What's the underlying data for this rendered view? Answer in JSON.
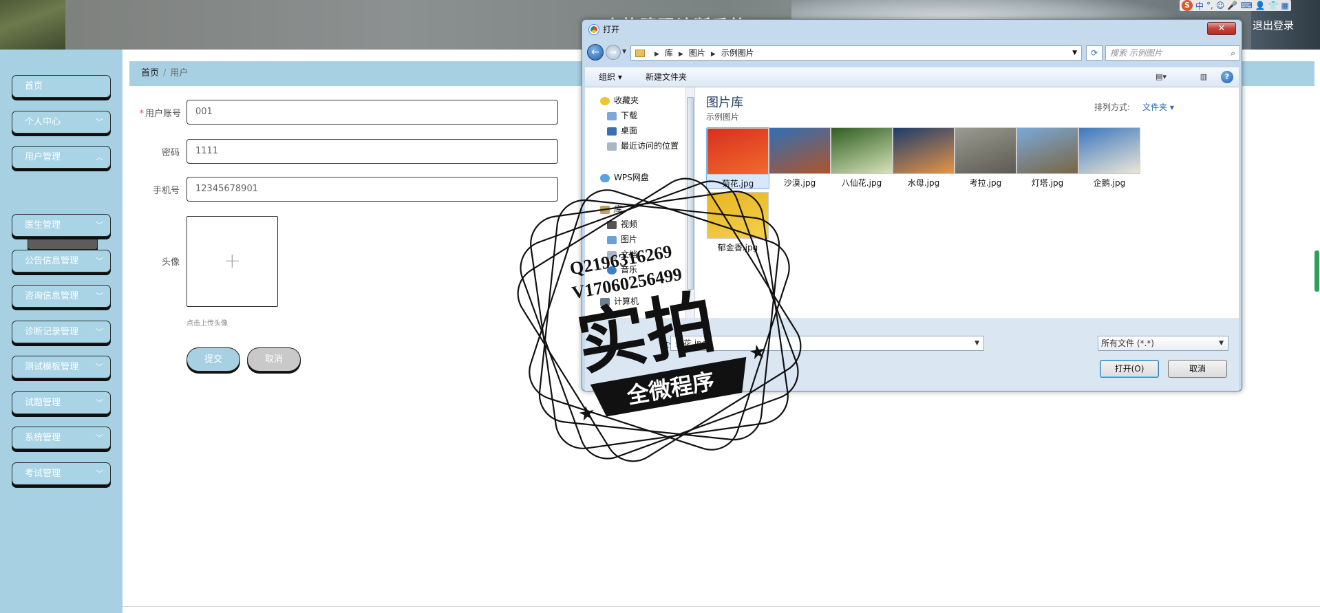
{
  "header": {
    "system_title": "人格障碍诊断系统",
    "logout": "退出登录",
    "ime": [
      "S",
      "中",
      "°,",
      "☺",
      "🎤",
      "⌨",
      "👤",
      "👕",
      "▦"
    ]
  },
  "sidebar": {
    "items": [
      {
        "label": "首页"
      },
      {
        "label": "个人中心"
      },
      {
        "label": "用户管理"
      },
      {
        "label": "医生管理"
      },
      {
        "label": "公告信息管理"
      },
      {
        "label": "咨询信息管理"
      },
      {
        "label": "诊断记录管理"
      },
      {
        "label": "测试模板管理"
      },
      {
        "label": "试题管理"
      },
      {
        "label": "系统管理"
      },
      {
        "label": "考试管理"
      }
    ],
    "sub_item": "用户"
  },
  "breadcrumb": {
    "home": "首页",
    "current": "用户"
  },
  "form": {
    "account_label": "用户账号",
    "account_value": "001",
    "password_label": "密码",
    "password_value": "1111",
    "phone_label": "手机号",
    "phone_value": "12345678901",
    "avatar_label": "头像",
    "avatar_plus": "+",
    "avatar_hint": "点击上传头像",
    "submit": "提交",
    "cancel": "取消"
  },
  "dialog": {
    "title": "打开",
    "close": "✕",
    "path": [
      "库",
      "图片",
      "示例图片"
    ],
    "search_placeholder": "搜索 示例图片",
    "toolbar": {
      "organize": "组织 ▾",
      "new_folder": "新建文件夹"
    },
    "tree": [
      {
        "label": "收藏夹",
        "color": "#f1c232"
      },
      {
        "label": "下载",
        "color": "#7da6d6"
      },
      {
        "label": "桌面",
        "color": "#3a6fb0"
      },
      {
        "label": "最近访问的位置",
        "color": "#aab6c4"
      },
      {
        "label": "WPS网盘",
        "color": "#5aa0e6"
      },
      {
        "label": "库",
        "color": "#c2a261"
      },
      {
        "label": "视频",
        "color": "#555"
      },
      {
        "label": "图片",
        "color": "#6aa2d8"
      },
      {
        "label": "文档",
        "color": "#aab6c4"
      },
      {
        "label": "音乐",
        "color": "#3c7fc4"
      },
      {
        "label": "计算机",
        "color": "#6b7e92"
      }
    ],
    "library_title": "图片库",
    "library_sub": "示例图片",
    "sort_label": "排列方式:",
    "sort_value": "文件夹 ▾",
    "thumbnails": [
      {
        "name": "菊花.jpg",
        "colors": [
          "#d7301f",
          "#f26a2c"
        ]
      },
      {
        "name": "沙漠.jpg",
        "colors": [
          "#2f6fb6",
          "#b0542a"
        ]
      },
      {
        "name": "八仙花.jpg",
        "colors": [
          "#2f5e22",
          "#d7e3b8"
        ]
      },
      {
        "name": "水母.jpg",
        "colors": [
          "#1b3c6e",
          "#e89445"
        ]
      },
      {
        "name": "考拉.jpg",
        "colors": [
          "#9b9b91",
          "#5c5a52"
        ]
      },
      {
        "name": "灯塔.jpg",
        "colors": [
          "#7aa9d8",
          "#7a6542"
        ]
      },
      {
        "name": "企鹅.jpg",
        "colors": [
          "#3c78c0",
          "#ece6d6"
        ]
      },
      {
        "name": "郁金香.jpg",
        "colors": [
          "#e8b623",
          "#f3d04a"
        ]
      }
    ],
    "filename_label": "文件名(N):",
    "filename_value": "菊花.jpg",
    "filetype": "所有文件 (*.*)",
    "open_btn": "打开(O)",
    "cancel_btn": "取消"
  },
  "watermark": {
    "line1": "Q2196316269",
    "line2": "V17060256499",
    "main": "实拍",
    "ribbon": "全微程序"
  }
}
